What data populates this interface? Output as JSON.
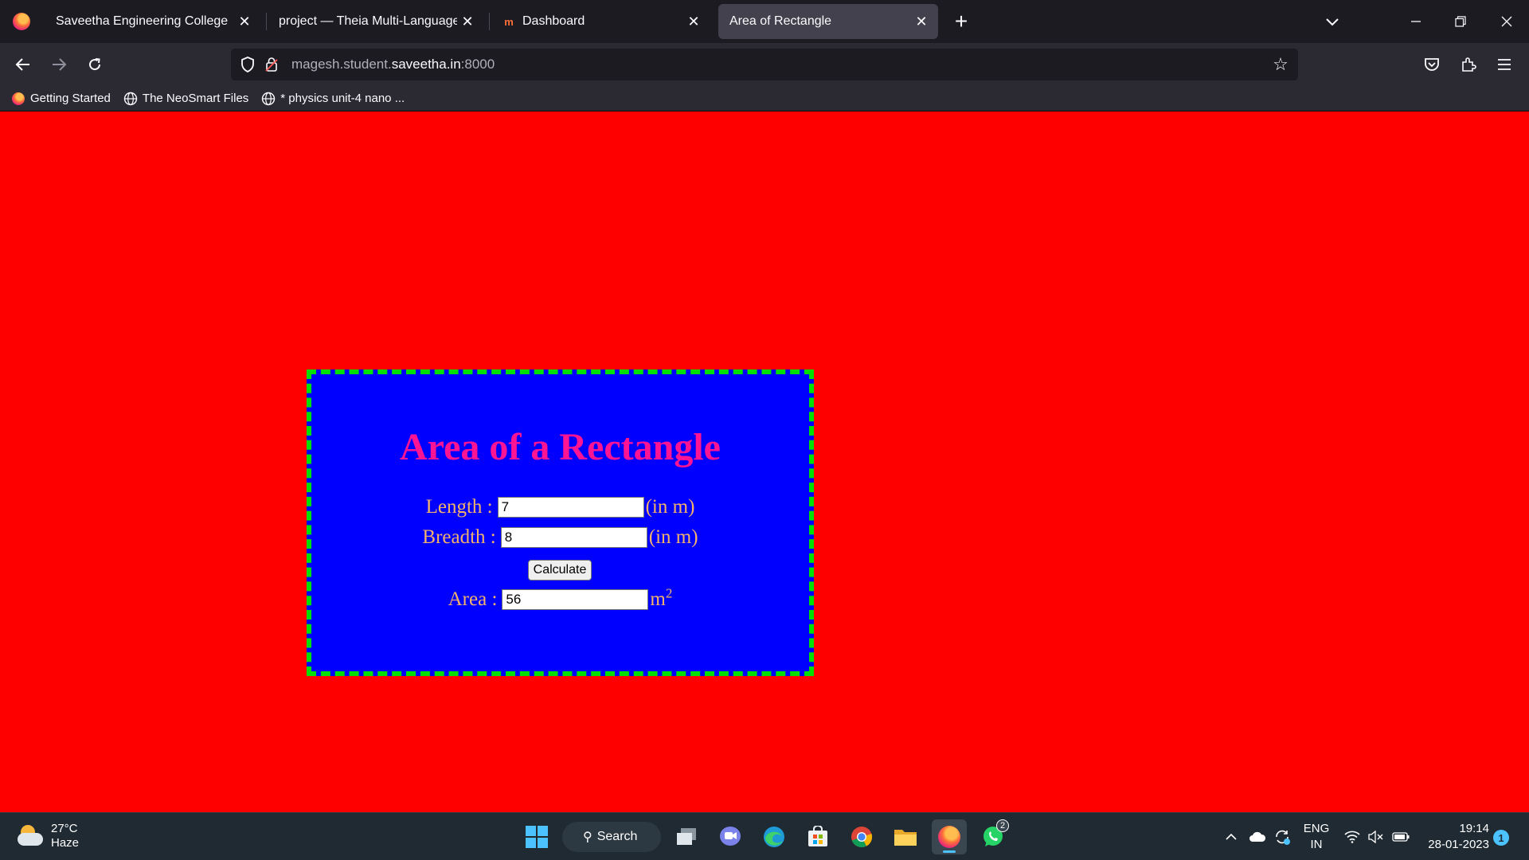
{
  "browser": {
    "tabs": [
      {
        "title": "Saveetha Engineering College",
        "active": false
      },
      {
        "title": "project — Theia Multi-Language Ex",
        "active": false
      },
      {
        "title": "Dashboard",
        "active": false
      },
      {
        "title": "Area of Rectangle",
        "active": true
      }
    ],
    "url": {
      "prefix": "magesh.student.",
      "host": "saveetha.in",
      "suffix": ":8000"
    },
    "bookmarks": [
      {
        "label": "Getting Started"
      },
      {
        "label": "The NeoSmart Files"
      },
      {
        "label": "* physics unit-4 nano ..."
      }
    ]
  },
  "page": {
    "title": "Area of a Rectangle",
    "length": {
      "label": "Length :",
      "value": "7",
      "unit": "(in m)"
    },
    "breadth": {
      "label": "Breadth :",
      "value": "8",
      "unit": "(in m)"
    },
    "calculate_label": "Calculate",
    "area": {
      "label": "Area :",
      "value": "56",
      "unit": "m",
      "unit_sup": "2"
    },
    "colors": {
      "background": "#ff0000",
      "box": "#0000ff",
      "border": "#00e000",
      "title": "#ff1493",
      "labels": "#f2b26b"
    }
  },
  "taskbar": {
    "weather": {
      "temp": "27°C",
      "desc": "Haze"
    },
    "search_label": "Search",
    "whatsapp_badge": "2",
    "lang": {
      "line1": "ENG",
      "line2": "IN"
    },
    "clock": {
      "time": "19:14",
      "date": "28-01-2023"
    },
    "notifications": "1"
  }
}
